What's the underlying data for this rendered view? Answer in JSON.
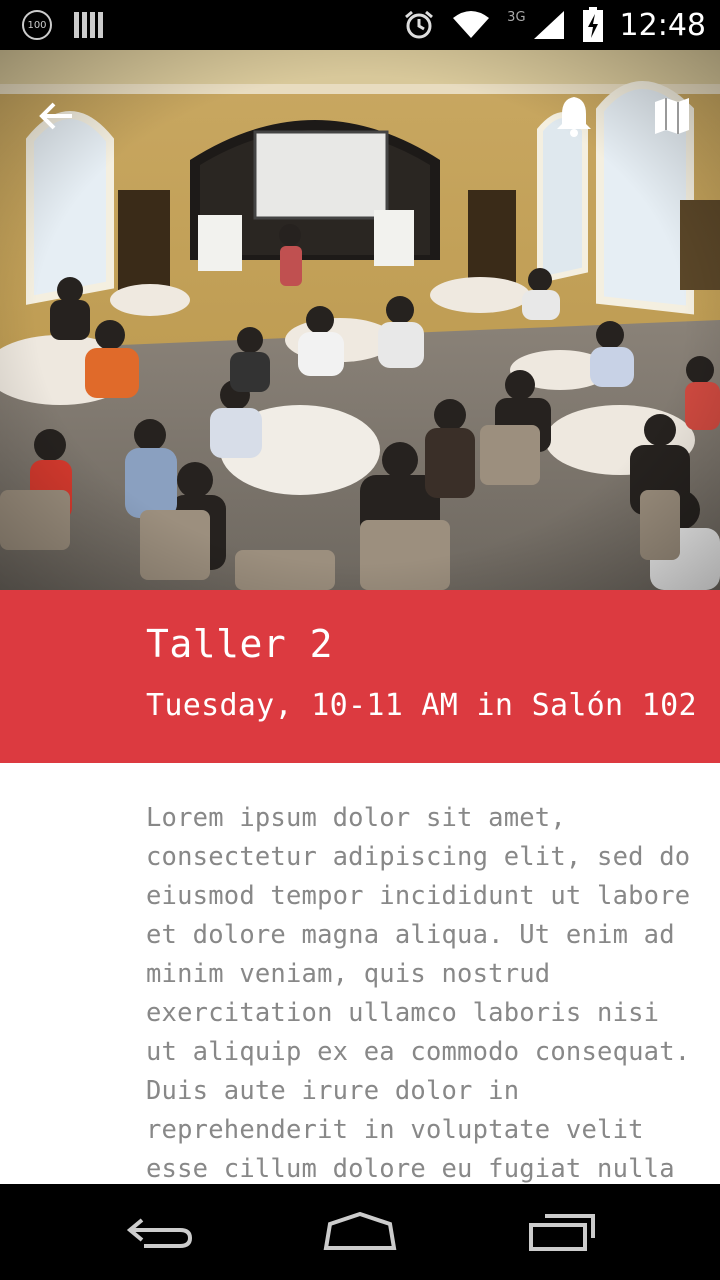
{
  "status_bar": {
    "battery_badge": "100",
    "network": "3G",
    "time": "12:48",
    "icons": [
      "notification-100-icon",
      "barcode-icon",
      "alarm-icon",
      "wifi-icon",
      "signal-icon",
      "battery-icon"
    ]
  },
  "hero": {
    "image": "conference-room-photo",
    "actions": [
      "back-arrow-icon",
      "bell-icon",
      "map-icon"
    ]
  },
  "event": {
    "title": "Taller 2",
    "subtitle": "Tuesday, 10-11 AM in Salón 102",
    "description": "Lorem ipsum dolor sit amet, consectetur adipiscing elit, sed do eiusmod tempor incididunt ut labore et dolore magna aliqua. Ut enim ad minim veniam, quis nostrud exercitation ullamco laboris nisi ut aliquip ex ea commodo consequat. Duis aute irure dolor in reprehenderit in voluptate velit esse cillum dolore eu fugiat nulla"
  },
  "nav_bar": {
    "buttons": [
      "back-icon",
      "home-icon",
      "recents-icon"
    ]
  },
  "colors": {
    "accent": "#dc3a40",
    "body_text": "#888888"
  }
}
